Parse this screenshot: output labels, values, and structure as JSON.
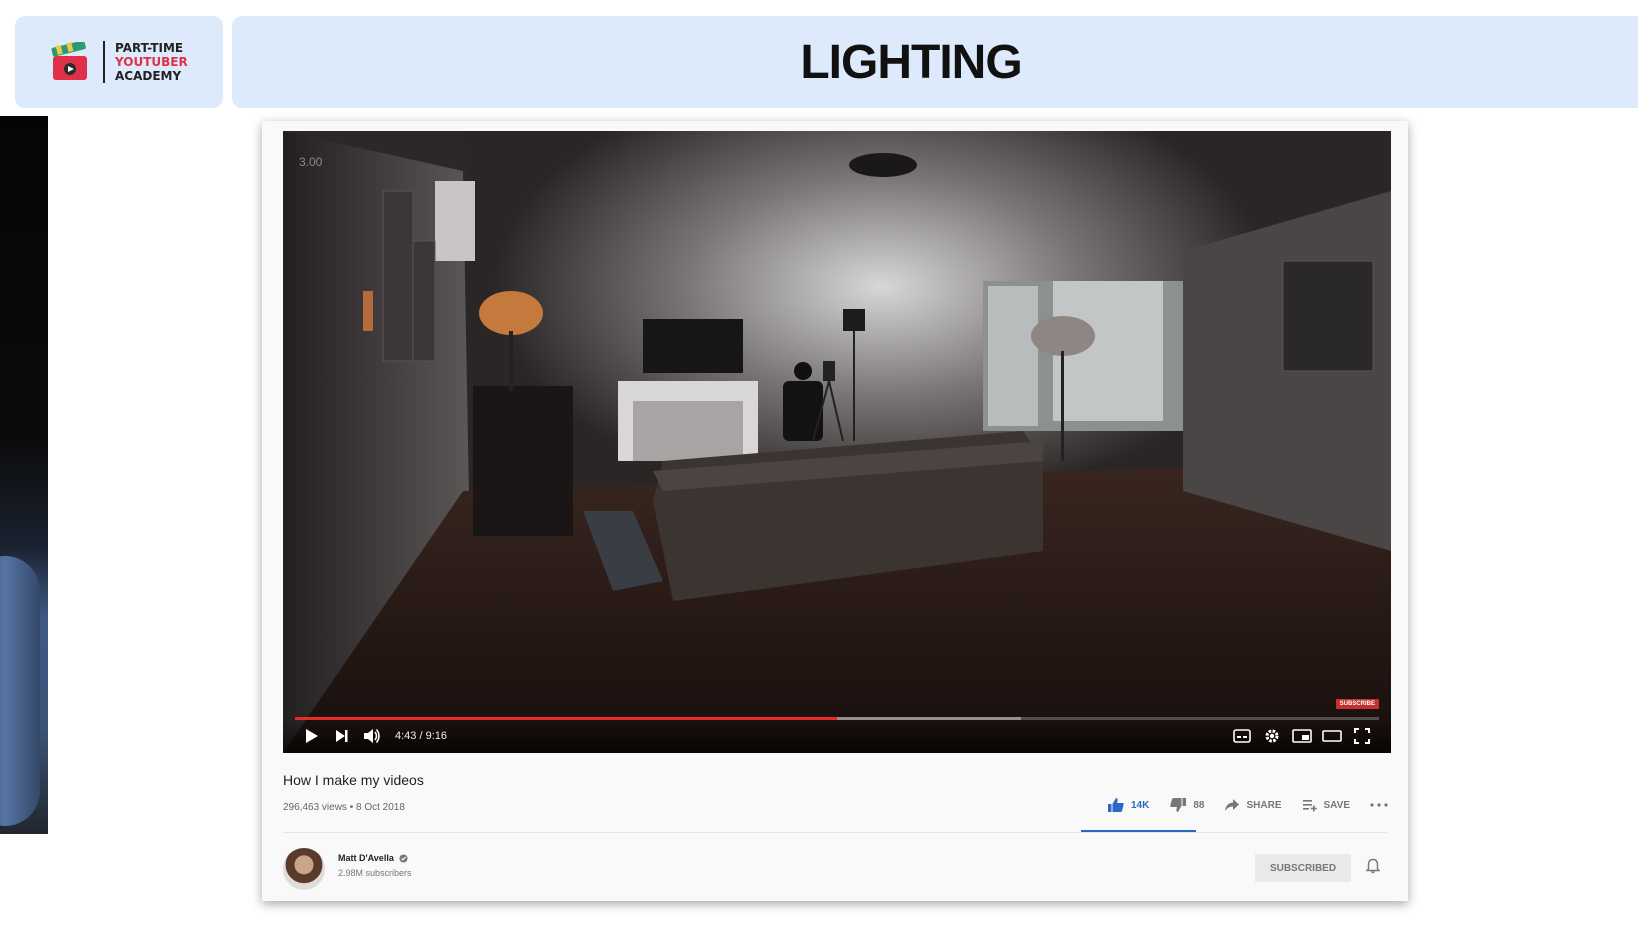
{
  "header": {
    "logo": {
      "line1": "PART-TIME",
      "line2": "YOUTUBER",
      "line3": "ACADEMY"
    },
    "title": "LIGHTING"
  },
  "player": {
    "speed_overlay": "3.00",
    "subscribe_watermark": "SUBSCRIBE",
    "timecode": "4:43 / 9:16",
    "progress_played": 0.5,
    "progress_buffered": 0.67,
    "controls": [
      "play-icon",
      "next-icon",
      "volume-icon",
      "captions-icon",
      "settings-icon",
      "miniplayer-icon",
      "theater-icon",
      "fullscreen-icon"
    ]
  },
  "video": {
    "title": "How I make my videos",
    "meta": "296,463 views • 8 Oct 2018",
    "actions": {
      "likes": "14K",
      "dislikes": "88",
      "share": "SHARE",
      "save": "SAVE"
    }
  },
  "channel": {
    "name": "Matt D'Avella",
    "verified": true,
    "subscribers": "2.98M subscribers",
    "subscribe_button": "SUBSCRIBED"
  },
  "colors": {
    "accent_blue": "#2a67c8",
    "progress_red": "#e52d27",
    "header_bg": "#dceafc"
  }
}
